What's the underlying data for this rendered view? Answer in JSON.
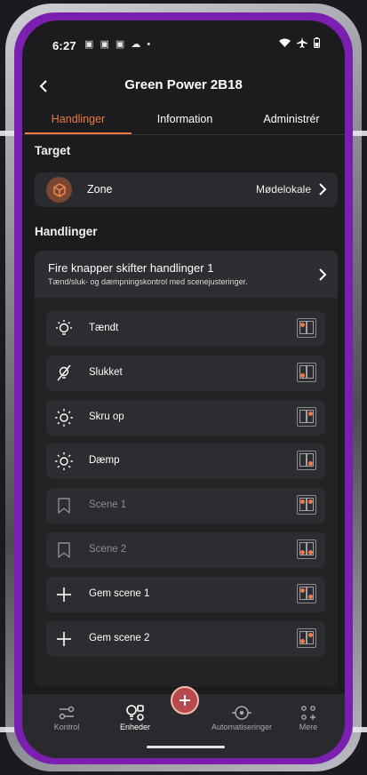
{
  "status_bar": {
    "time": "6:27",
    "notifications": "▣ ▣ ▣ ☁ •"
  },
  "header": {
    "title": "Green Power 2B18"
  },
  "tabs": [
    {
      "label": "Handlinger",
      "active": true
    },
    {
      "label": "Information",
      "active": false
    },
    {
      "label": "Administrér",
      "active": false
    }
  ],
  "target": {
    "heading": "Target",
    "zone_label": "Zone",
    "zone_value": "Mødelokale"
  },
  "actions": {
    "heading": "Handlinger",
    "title": "Fire knapper skifter handlinger 1",
    "subtitle": "Tænd/sluk- og dæmpningskontrol med scenejusteringer.",
    "items": [
      {
        "label": "Tændt",
        "icon": "bulb-on-icon",
        "enabled": true,
        "dots": [
          "tl"
        ]
      },
      {
        "label": "Slukket",
        "icon": "bulb-off-icon",
        "enabled": true,
        "dots": [
          "bl"
        ]
      },
      {
        "label": "Skru op",
        "icon": "sun-icon",
        "enabled": true,
        "dots": [
          "tr"
        ]
      },
      {
        "label": "Dæmp",
        "icon": "sun-icon",
        "enabled": true,
        "dots": [
          "br"
        ]
      },
      {
        "label": "Scene 1",
        "icon": "bookmark-icon",
        "enabled": false,
        "dots": [
          "tl",
          "tr"
        ]
      },
      {
        "label": "Scene 2",
        "icon": "bookmark-icon",
        "enabled": false,
        "dots": [
          "bl",
          "br"
        ]
      },
      {
        "label": "Gem scene 1",
        "icon": "plus-icon",
        "enabled": true,
        "dots": [
          "tl",
          "br"
        ]
      },
      {
        "label": "Gem scene 2",
        "icon": "plus-icon",
        "enabled": true,
        "dots": [
          "tr",
          "bl"
        ]
      }
    ]
  },
  "bottom_nav": [
    {
      "label": "Kontrol",
      "icon": "sliders-icon",
      "active": false
    },
    {
      "label": "Enheder",
      "icon": "devices-icon",
      "active": true
    },
    {
      "label": "Automatiseringer",
      "icon": "automation-icon",
      "active": false
    },
    {
      "label": "Mere",
      "icon": "more-icon",
      "active": false
    }
  ],
  "colors": {
    "accent": "#ee7a43",
    "frame": "#7a1fb0",
    "background": "#1c1c1f"
  }
}
